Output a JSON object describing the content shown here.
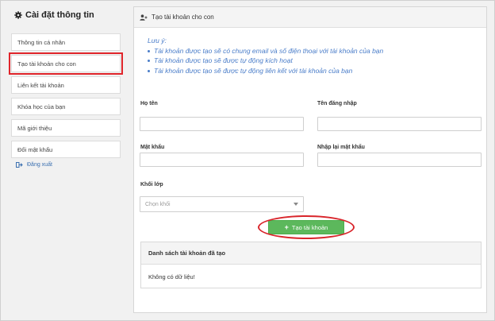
{
  "sidebar": {
    "title": "Cài đặt thông tin",
    "items": [
      {
        "label": "Thông tin cá nhân"
      },
      {
        "label": "Tạo tài khoản cho con"
      },
      {
        "label": "Liên kết tài khoản"
      },
      {
        "label": "Khóa học của bạn"
      },
      {
        "label": "Mã giới thiệu"
      },
      {
        "label": "Đổi mật khẩu"
      }
    ],
    "logout_label": "Đăng xuất"
  },
  "panel": {
    "title": "Tạo tài khoản cho con",
    "note_title": "Lưu ý:",
    "notes": [
      "Tài khoản được tạo sẽ có chung email và số điện thoại với tài khoản của bạn",
      "Tài khoản được tạo sẽ được tự động kích hoạt",
      "Tài khoản được tạo sẽ được tự động liên kết với tài khoản của bạn"
    ]
  },
  "form": {
    "fullname_label": "Họ tên",
    "username_label": "Tên đăng nhập",
    "password_label": "Mật khẩu",
    "password_confirm_label": "Nhập lại mật khẩu",
    "grade_label": "Khối lớp",
    "grade_placeholder": "Chọn khối",
    "submit_label": "Tạo tài khoản"
  },
  "account_list": {
    "title": "Danh sách tài khoản đã tạo",
    "empty_text": "Không có dữ liệu!"
  },
  "colors": {
    "accent_blue": "#4a7dc9",
    "button_green": "#5cb85c",
    "highlight_red": "#e0252b"
  },
  "icons": {
    "settings": "gear-icon",
    "logout": "logout-icon",
    "panel": "user-plus-icon",
    "select": "chevron-down-icon"
  }
}
